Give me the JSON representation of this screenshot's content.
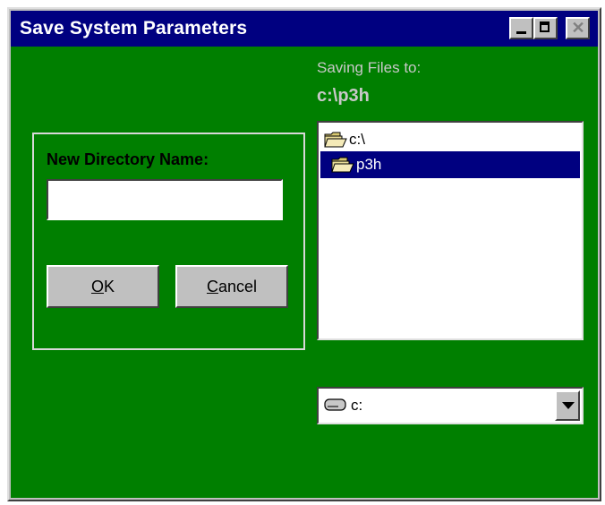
{
  "window": {
    "title": "Save System Parameters"
  },
  "dest": {
    "saving_label": "Saving Files to:",
    "path": "c:\\p3h"
  },
  "new_dir": {
    "label": "New Directory Name:",
    "value": "",
    "ok_label_rest": "K",
    "ok_label_key": "O",
    "cancel_label_rest": "ancel",
    "cancel_label_key": "C"
  },
  "tree": {
    "items": [
      {
        "label": "c:\\",
        "icon": "folder-open-icon",
        "selected": false
      },
      {
        "label": "p3h",
        "icon": "folder-open-icon",
        "selected": true
      }
    ]
  },
  "drive": {
    "selected": "c:",
    "icon": "drive-icon"
  },
  "colors": {
    "client_bg": "#007f00",
    "titlebar": "#000080",
    "selection": "#000080"
  }
}
